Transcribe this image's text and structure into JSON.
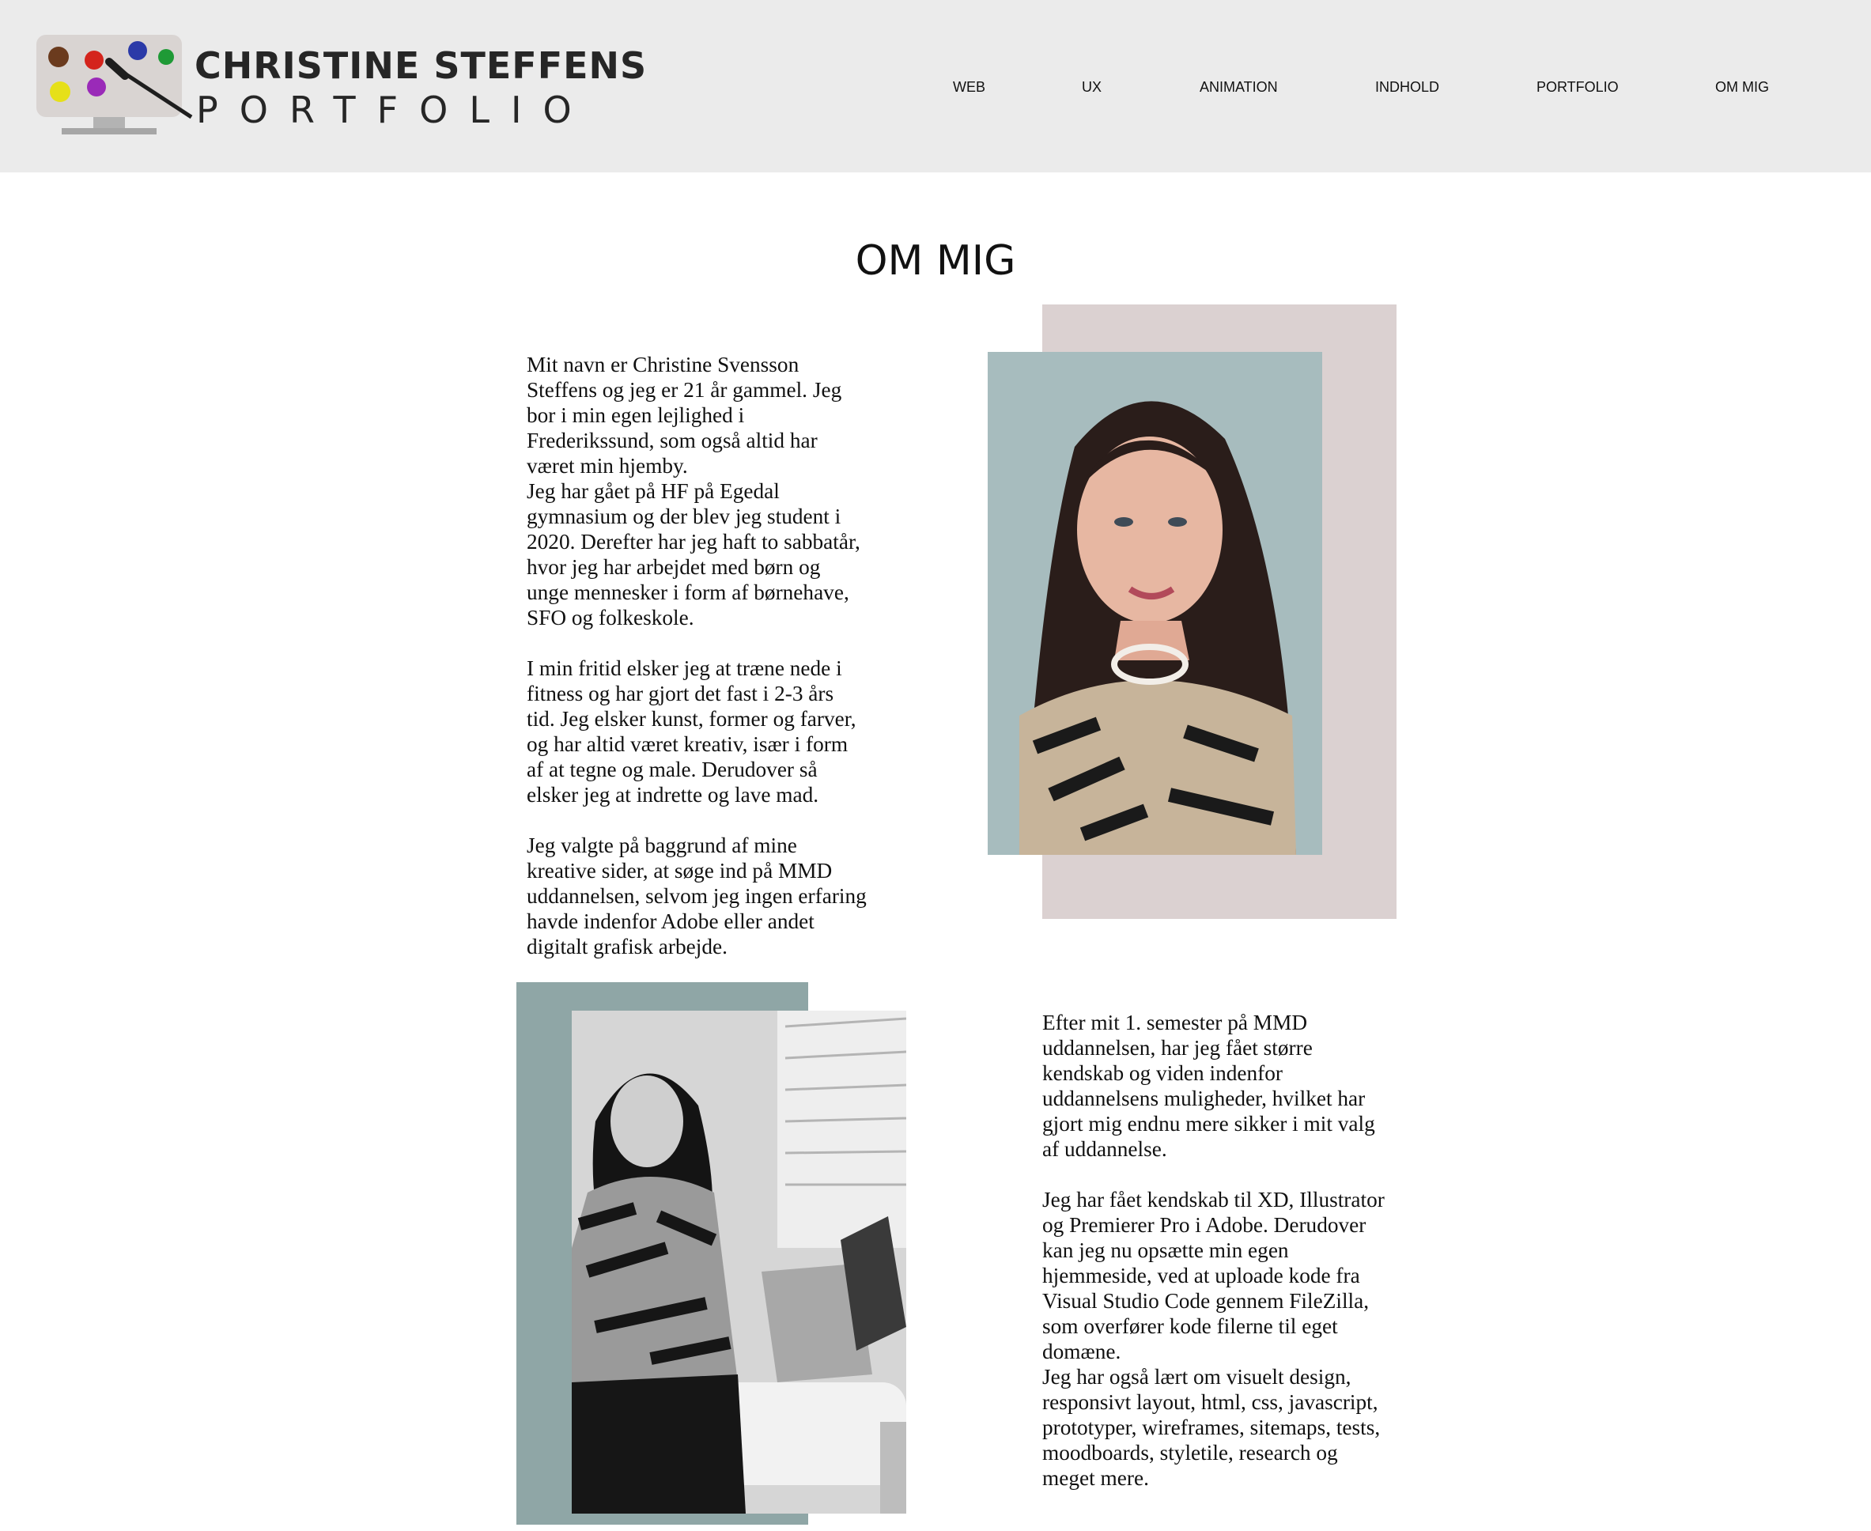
{
  "header": {
    "brand_name": "CHRISTINE STEFFENS",
    "brand_sub": "PORTFOLIO",
    "logo_icon": "painter-palette-monitor-icon"
  },
  "nav": {
    "items": [
      {
        "label": "WEB"
      },
      {
        "label": "UX"
      },
      {
        "label": "ANIMATION"
      },
      {
        "label": "INDHOLD"
      },
      {
        "label": "PORTFOLIO"
      },
      {
        "label": "OM MIG"
      }
    ]
  },
  "main": {
    "title": "OM MIG",
    "intro": {
      "p1": "Mit navn er Christine Svensson Steffens og jeg er 21 år gammel. Jeg bor i min egen lejlighed i Frederikssund, som også altid har været min hjemby.",
      "p2": "Jeg har gået på HF på Egedal gymnasium og der blev jeg student i 2020. Derefter har jeg haft to sabbatår, hvor jeg har arbejdet med børn og unge mennesker i form af børnehave, SFO og folkeskole.",
      "p3": "I min fritid elsker jeg at træne nede i fitness og har gjort det fast i 2-3 års tid. Jeg elsker kunst, former og farver, og har altid været kreativ, især i form af at tegne og male. Derudover så elsker jeg at indrette og lave mad.",
      "p4": "Jeg valgte på baggrund af mine kreative sider, at søge ind på MMD uddannelsen, selvom jeg ingen erfaring havde indenfor Adobe eller andet digitalt grafisk arbejde."
    },
    "education": {
      "p1": "Efter mit 1. semester på MMD uddannelsen, har jeg fået større kendskab og viden indenfor uddannelsens muligheder, hvilket har gjort mig endnu mere sikker i mit valg af uddannelse.",
      "p2": "Jeg har fået kendskab til XD, Illustrator og Premierer Pro i Adobe. Derudover kan jeg nu opsætte min egen hjemmeside, ved at uploade kode fra Visual Studio Code gennem FileZilla, som overfører kode filerne til eget domæne.",
      "p3": "Jeg har også lært om visuelt design, responsivt layout, html, css, javascript, prototyper, wireframes, sitemaps, tests, moodboards, styletile, research og meget mere."
    }
  },
  "colors": {
    "header_bg": "#ebebeb",
    "portrait_backdrop": "#dbd1d1",
    "sitting_backdrop": "#8fa6a6",
    "text": "#111111"
  }
}
